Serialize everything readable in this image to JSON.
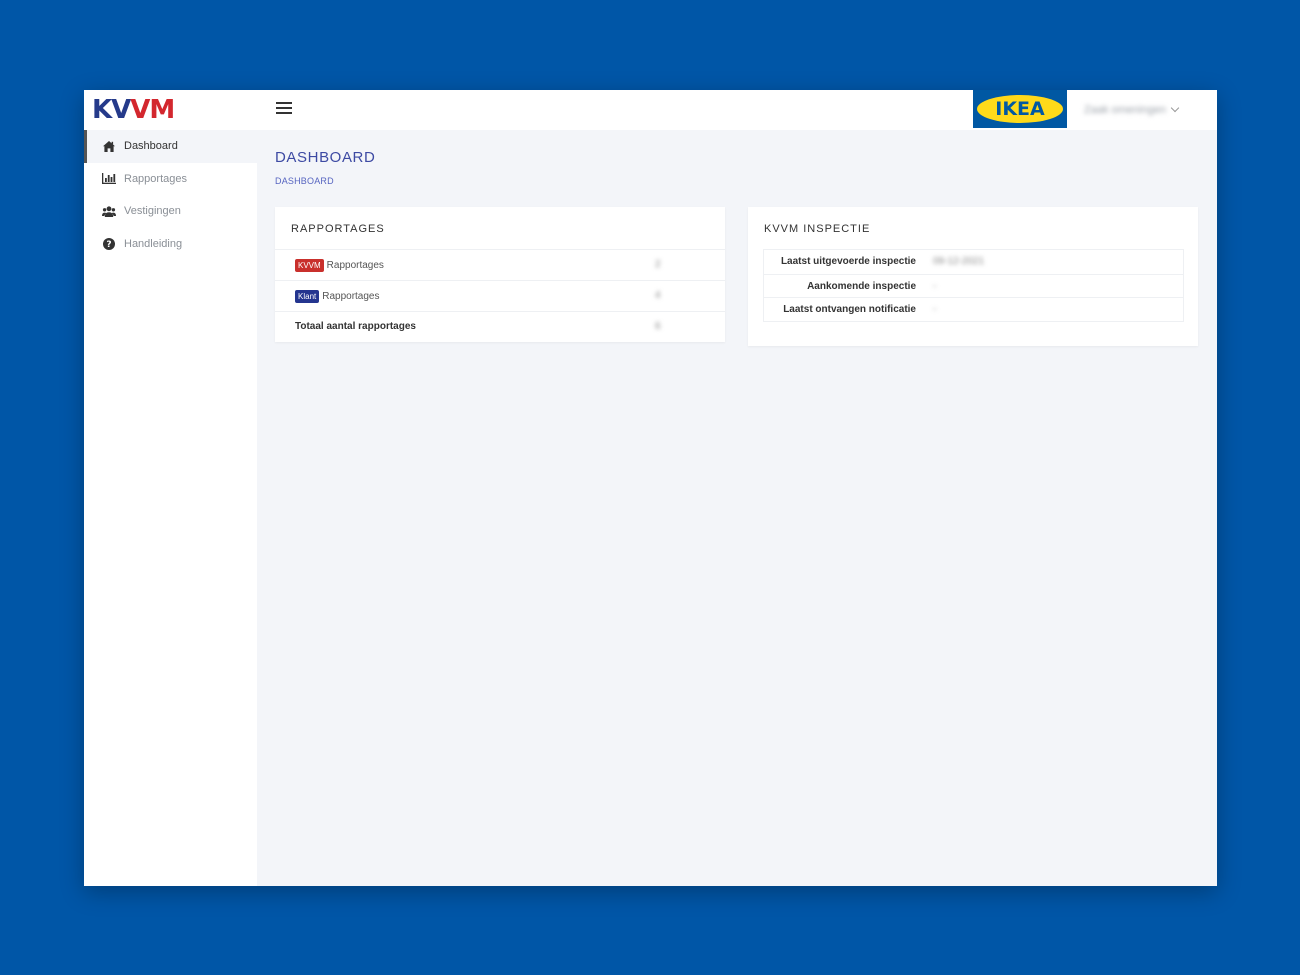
{
  "header": {
    "logo_part1": "KV",
    "logo_part2": "VM",
    "menu_icon": "hamburger-icon",
    "brand_logo": "IKEA",
    "user_name": "Zaak omeningen",
    "dropdown_icon": "chevron-down-icon"
  },
  "sidebar": {
    "items": [
      {
        "label": "Dashboard",
        "icon": "home-icon",
        "active": true
      },
      {
        "label": "Rapportages",
        "icon": "bar-chart-icon",
        "active": false
      },
      {
        "label": "Vestigingen",
        "icon": "users-icon",
        "active": false
      },
      {
        "label": "Handleiding",
        "icon": "question-circle-icon",
        "active": false
      }
    ]
  },
  "main": {
    "title": "DASHBOARD",
    "breadcrumb": "DASHBOARD",
    "rapportages": {
      "title": "RAPPORTAGES",
      "rows": [
        {
          "badge": "KVVM",
          "label": "Rapportages",
          "value": "2"
        },
        {
          "badge": "Klant",
          "label": "Rapportages",
          "value": "4"
        },
        {
          "label": "Totaal aantal rapportages",
          "value": "6"
        }
      ]
    },
    "inspectie": {
      "title": "KVVM INSPECTIE",
      "rows": [
        {
          "label": "Laatst uitgevoerde inspectie",
          "value": "09-12-2021"
        },
        {
          "label": "Aankomende inspectie",
          "value": "-"
        },
        {
          "label": "Laatst ontvangen notificatie",
          "value": "-"
        }
      ]
    }
  },
  "colors": {
    "background": "#0056a7",
    "accent": "#3d4aa3",
    "badge_kvvm": "#c9302c",
    "badge_klant": "#24358f",
    "brand_blue": "#0058a3",
    "brand_yellow": "#ffda1a"
  }
}
